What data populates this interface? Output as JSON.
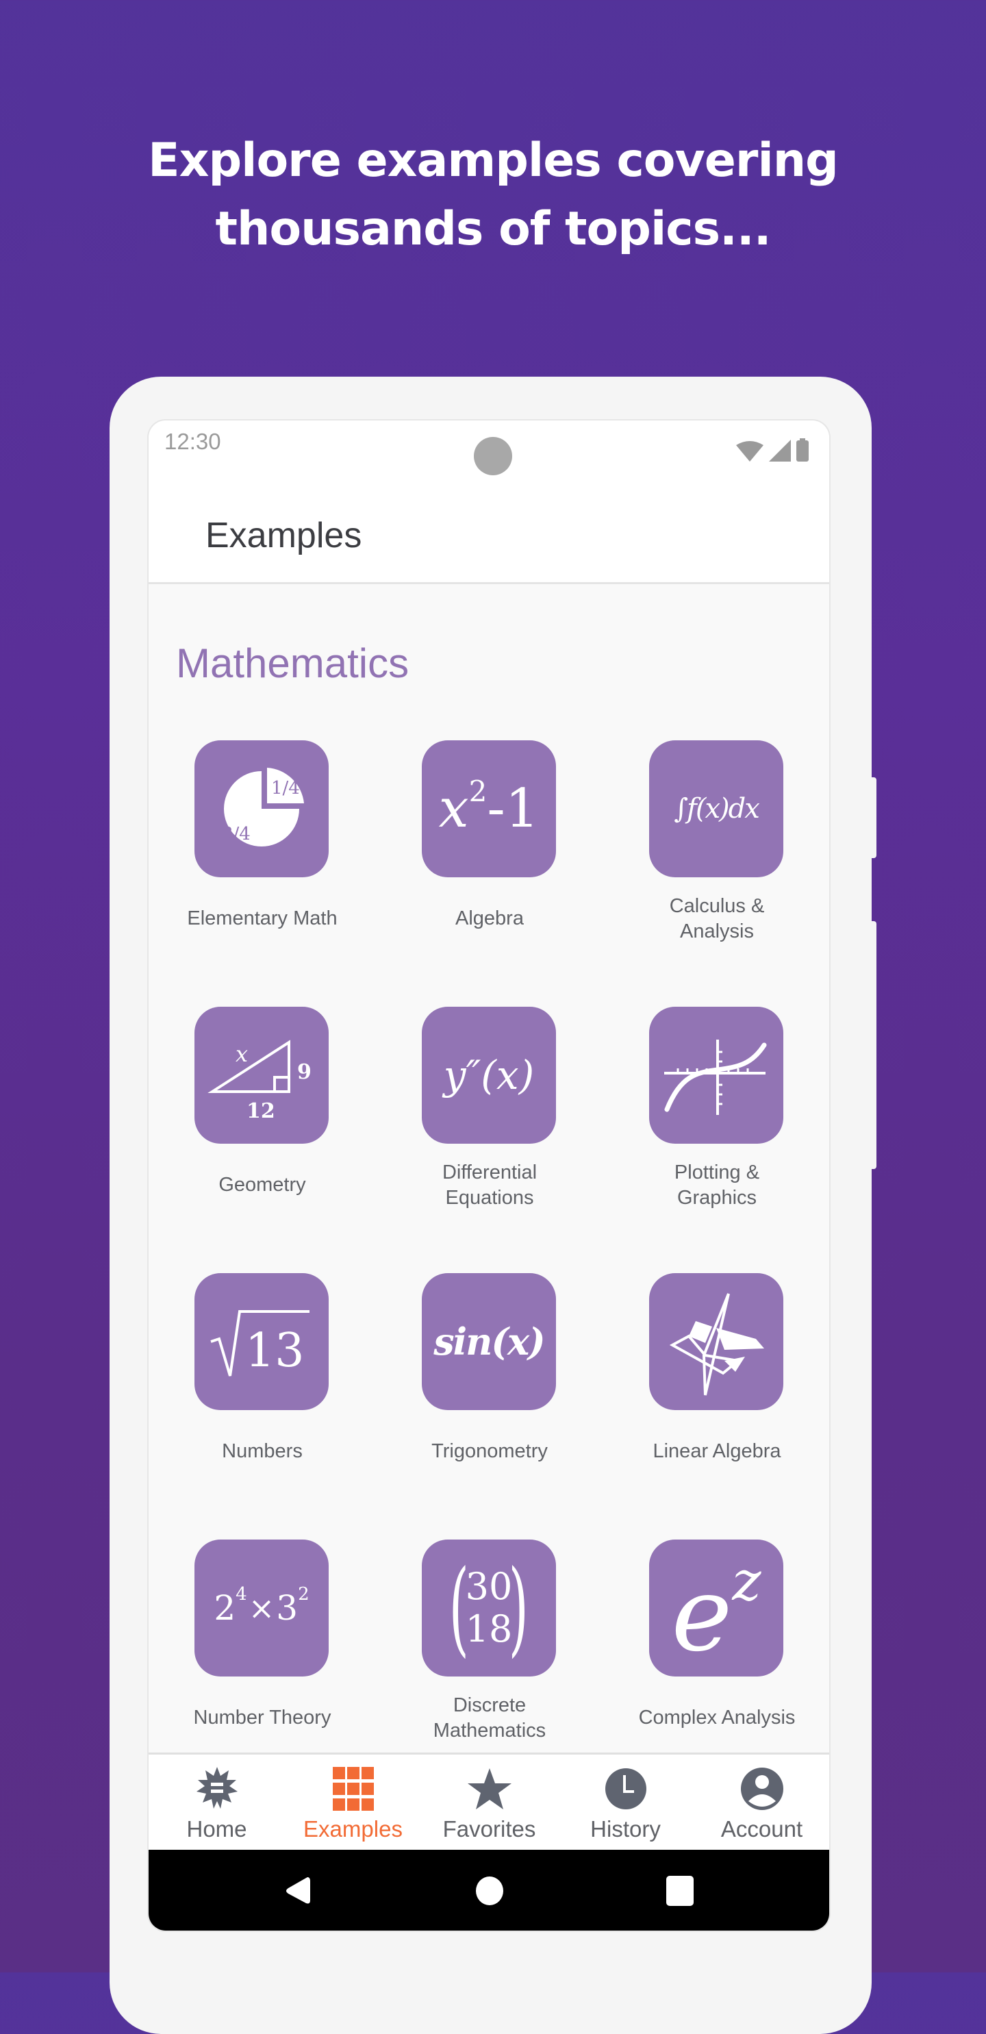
{
  "headline": {
    "line1": "Explore examples covering",
    "line2": "thousands of topics..."
  },
  "status_bar": {
    "time": "12:30",
    "icons": [
      "wifi-icon",
      "signal-icon",
      "battery-icon"
    ]
  },
  "app_bar": {
    "title": "Examples"
  },
  "section": {
    "title": "Mathematics",
    "accent_color": "#9173b3",
    "tile_color": "#9274b4",
    "items": [
      {
        "label_lines": [
          "Elementary Math"
        ],
        "icon": "pie-fraction-icon",
        "glyph": {
          "a": "1/4",
          "b": "3/4"
        }
      },
      {
        "label_lines": [
          "Algebra"
        ],
        "icon": "polynomial-icon",
        "glyph": {
          "base": "x",
          "sup": "2",
          "rest": "-1"
        }
      },
      {
        "label_lines": [
          "Calculus &",
          "Analysis"
        ],
        "icon": "integral-icon",
        "glyph": {
          "text": "∫f(x)dx"
        }
      },
      {
        "label_lines": [
          "Geometry"
        ],
        "icon": "right-triangle-icon",
        "glyph": {
          "hyp": "x",
          "side": "9",
          "base": "12"
        }
      },
      {
        "label_lines": [
          "Differential",
          "Equations"
        ],
        "icon": "derivative-icon",
        "glyph": {
          "text": "y″(x)"
        }
      },
      {
        "label_lines": [
          "Plotting &",
          "Graphics"
        ],
        "icon": "curve-plot-icon",
        "glyph": {}
      },
      {
        "label_lines": [
          "Numbers"
        ],
        "icon": "square-root-icon",
        "glyph": {
          "radicand": "13"
        }
      },
      {
        "label_lines": [
          "Trigonometry"
        ],
        "icon": "sine-icon",
        "glyph": {
          "text": "sin(x)"
        }
      },
      {
        "label_lines": [
          "Linear Algebra"
        ],
        "icon": "intersecting-planes-icon",
        "glyph": {}
      },
      {
        "label_lines": [
          "Number Theory"
        ],
        "icon": "prime-factor-icon",
        "glyph": {
          "b1": "2",
          "e1": "4",
          "op": "×",
          "b2": "3",
          "e2": "2"
        }
      },
      {
        "label_lines": [
          "Discrete",
          "Mathematics"
        ],
        "icon": "binomial-icon",
        "glyph": {
          "top": "30",
          "bottom": "18"
        }
      },
      {
        "label_lines": [
          "Complex Analysis"
        ],
        "icon": "exponential-icon",
        "glyph": {
          "base": "e",
          "sup": "z"
        }
      }
    ]
  },
  "bottom_nav": {
    "active_color": "#f26b35",
    "inactive_color": "#5f6166",
    "items": [
      {
        "label": "Home",
        "icon": "home-spikey-icon",
        "active": false
      },
      {
        "label": "Examples",
        "icon": "grid-icon",
        "active": true
      },
      {
        "label": "Favorites",
        "icon": "star-icon",
        "active": false
      },
      {
        "label": "History",
        "icon": "clock-icon",
        "active": false
      },
      {
        "label": "Account",
        "icon": "account-icon",
        "active": false
      }
    ]
  },
  "system_nav": {
    "buttons": [
      "back-icon",
      "home-icon",
      "recents-icon"
    ]
  }
}
